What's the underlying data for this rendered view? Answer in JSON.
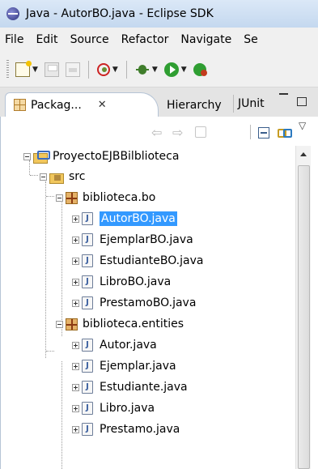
{
  "window": {
    "title": "Java - AutorBO.java - Eclipse SDK"
  },
  "menu": [
    "File",
    "Edit",
    "Source",
    "Refactor",
    "Navigate",
    "Se"
  ],
  "view": {
    "tabs": {
      "active": "Packag...",
      "close_glyph": "✕",
      "hierarchy": "Hierarchy",
      "junit": "JUnit"
    }
  },
  "tree": {
    "project": "ProyectoEJBBilblioteca",
    "src": "src",
    "packages": [
      {
        "name": "biblioteca.bo",
        "files": [
          "AutorBO.java",
          "EjemplarBO.java",
          "EstudianteBO.java",
          "LibroBO.java",
          "PrestamoBO.java"
        ]
      },
      {
        "name": "biblioteca.entities",
        "files": [
          "Autor.java",
          "Ejemplar.java",
          "Estudiante.java",
          "Libro.java",
          "Prestamo.java"
        ]
      }
    ],
    "selected_file": "AutorBO.java",
    "java_icon_letter": "J"
  }
}
